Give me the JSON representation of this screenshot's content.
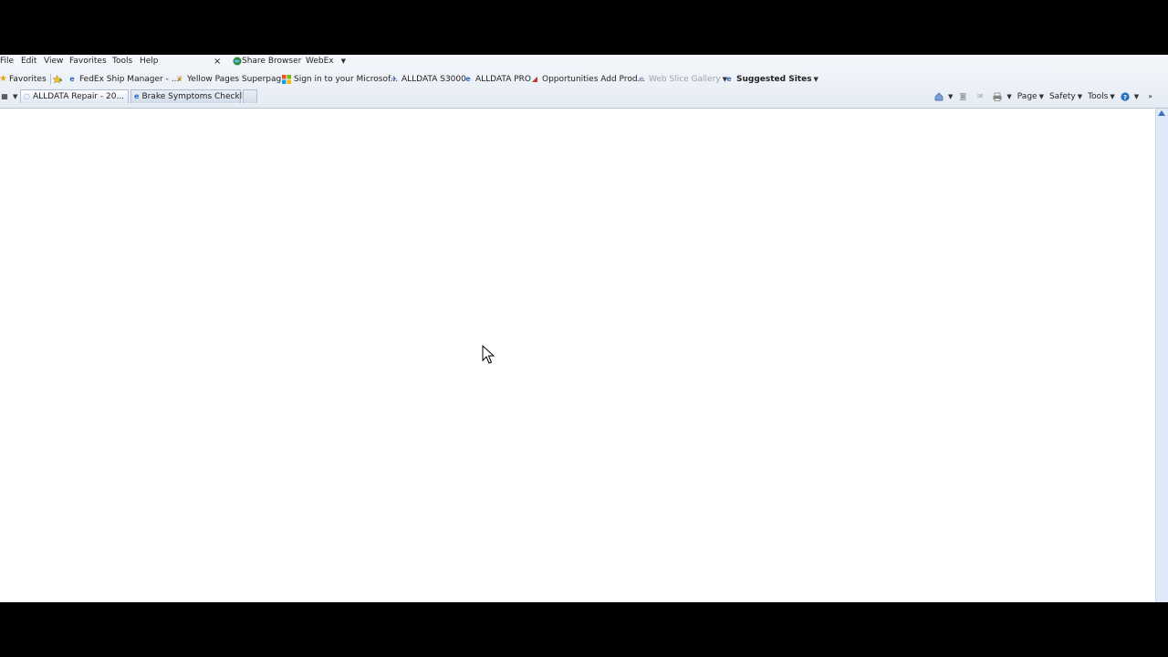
{
  "menubar": {
    "items": [
      "File",
      "Edit",
      "View",
      "Favorites",
      "Tools",
      "Help"
    ],
    "close_glyph": "×",
    "share_browser": "Share Browser",
    "webex": "WebEx"
  },
  "favorites_bar": {
    "favorites_label": "Favorites",
    "links": [
      "FedEx Ship Manager - ...",
      "Yellow Pages Superpag...",
      "Sign in to your Microsof...",
      "ALLDATA S3000",
      "ALLDATA PRO",
      "Opportunities Add Prod...",
      "Web Slice Gallery",
      "Suggested Sites"
    ]
  },
  "tabs": {
    "active": "ALLDATA Repair - 20...",
    "inactive": "Brake Symptoms Checklist",
    "close_glyph": "×"
  },
  "command_bar": {
    "page": "Page",
    "safety": "Safety",
    "tools": "Tools"
  },
  "icons": {
    "favorites_star": "star-icon",
    "ie_page": "ie-page-icon",
    "webex": "webex-globe-icon",
    "home": "home-icon",
    "feeds": "rss-icon",
    "mail": "mail-icon",
    "print": "print-icon",
    "help": "help-icon"
  },
  "colors": {
    "chrome_bg": "#e9eef5",
    "content_bg": "#ffffff",
    "scrollbar_bg": "#dfe9f7",
    "frame_bg": "#000000",
    "link_blue": "#2b6cc2"
  }
}
